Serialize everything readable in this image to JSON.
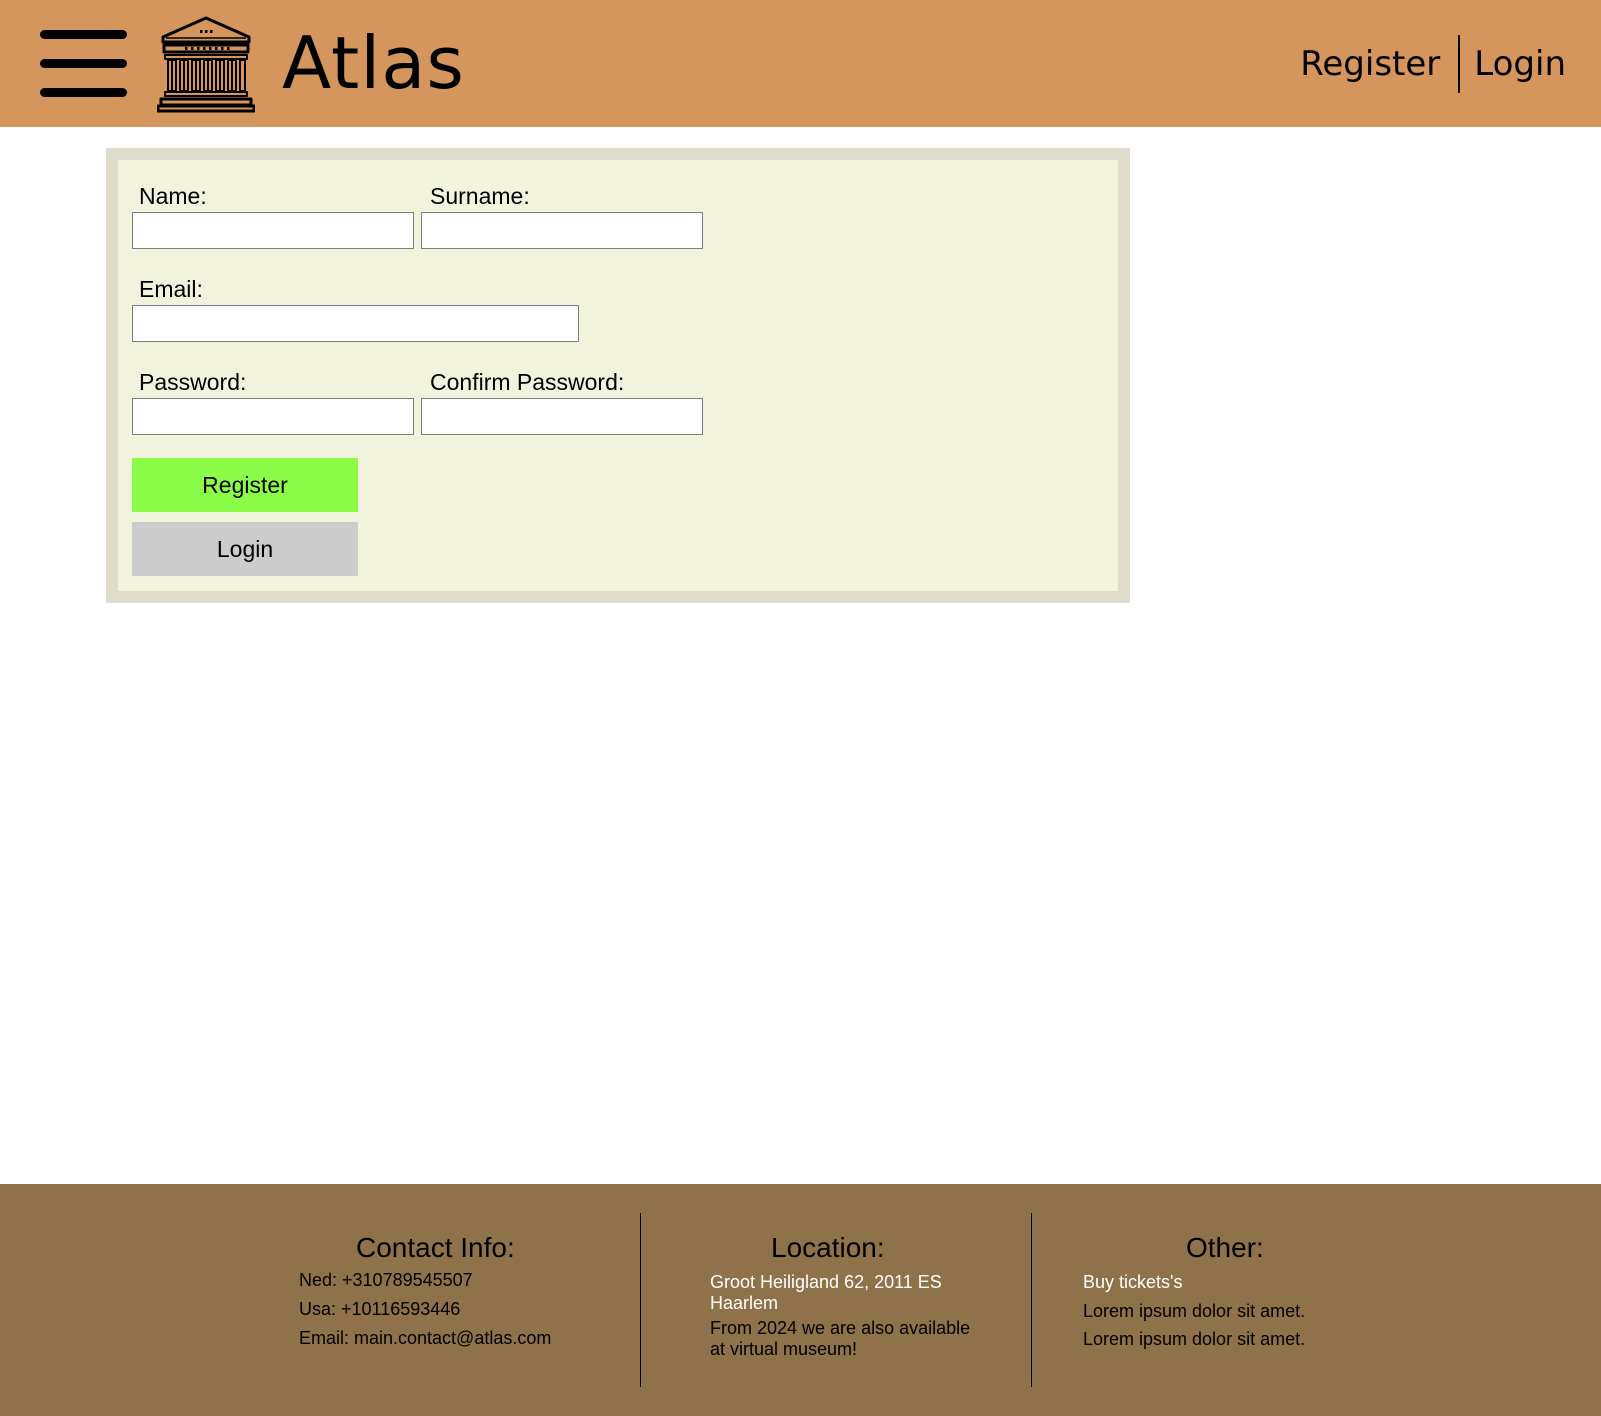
{
  "header": {
    "brand": "Atlas",
    "nav": {
      "register_label": "Register",
      "login_label": "Login"
    },
    "icons": {
      "menu": "hamburger-menu-icon",
      "logo": "museum-building-icon"
    },
    "background_color": "#d4965d"
  },
  "form": {
    "name_label": "Name:",
    "name_value": "",
    "surname_label": "Surname:",
    "surname_value": "",
    "email_label": "Email:",
    "email_value": "",
    "password_label": "Password:",
    "password_value": "",
    "confirm_password_label": "Confirm Password:",
    "confirm_password_value": "",
    "register_button": "Register",
    "login_button": "Login",
    "register_button_color": "#8bfd48",
    "login_button_color": "#cccccc",
    "panel_color": "#f2f3dc",
    "panel_border_color": "#dfdccb"
  },
  "footer": {
    "background_color": "#8f7249",
    "contact": {
      "title": "Contact Info:",
      "ned": "Ned: +310789545507",
      "usa": "Usa: +10116593446",
      "email": "Email: main.contact@atlas.com"
    },
    "location": {
      "title": "Location:",
      "address_line1": "Groot Heiligland 62, 2011 ES",
      "address_line2": "Haarlem",
      "note_line1": "From 2024 we are also available",
      "note_line2": "at virtual museum!"
    },
    "other": {
      "title": "Other:",
      "link": "Buy tickets's",
      "line1": "Lorem ipsum dolor sit amet.",
      "line2": "Lorem ipsum dolor sit amet."
    }
  }
}
